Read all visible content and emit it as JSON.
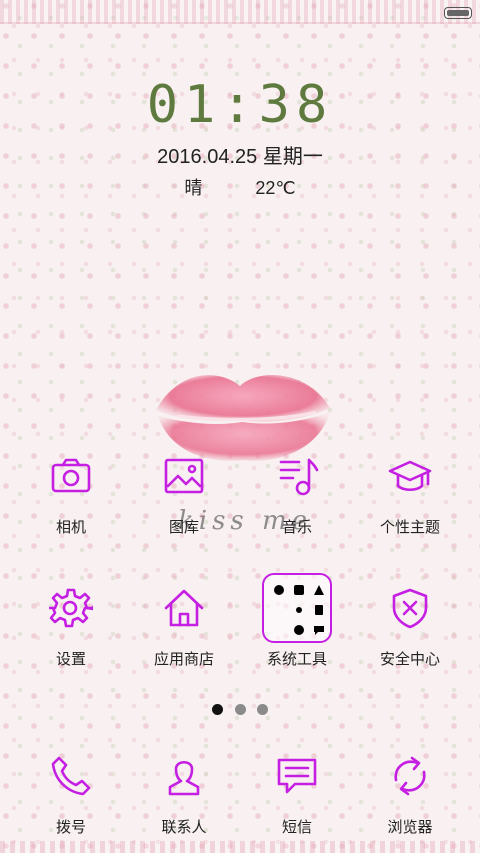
{
  "status_bar": {
    "battery_icon": "battery-icon"
  },
  "lockscreen": {
    "time": "01:38",
    "date": "2016.04.25  星期一",
    "weather": "晴",
    "temperature": "22℃"
  },
  "wallpaper": {
    "caption": "kiss me"
  },
  "apps_row1": [
    {
      "label": "相机",
      "icon": "camera-icon"
    },
    {
      "label": "图库",
      "icon": "gallery-icon"
    },
    {
      "label": "音乐",
      "icon": "music-icon"
    },
    {
      "label": "个性主题",
      "icon": "theme-icon"
    }
  ],
  "apps_row2": [
    {
      "label": "设置",
      "icon": "settings-icon"
    },
    {
      "label": "应用商店",
      "icon": "app-store-icon"
    },
    {
      "label": "系统工具",
      "icon": "folder-icon"
    },
    {
      "label": "安全中心",
      "icon": "security-icon"
    }
  ],
  "page_indicator": {
    "pages": 3,
    "current": 1
  },
  "dock": [
    {
      "label": "拨号",
      "icon": "phone-icon"
    },
    {
      "label": "联系人",
      "icon": "contacts-icon"
    },
    {
      "label": "短信",
      "icon": "messages-icon"
    },
    {
      "label": "浏览器",
      "icon": "browser-icon"
    }
  ],
  "colors": {
    "icon_accent": "#c51fe3",
    "clock": "#5e7a3e"
  }
}
